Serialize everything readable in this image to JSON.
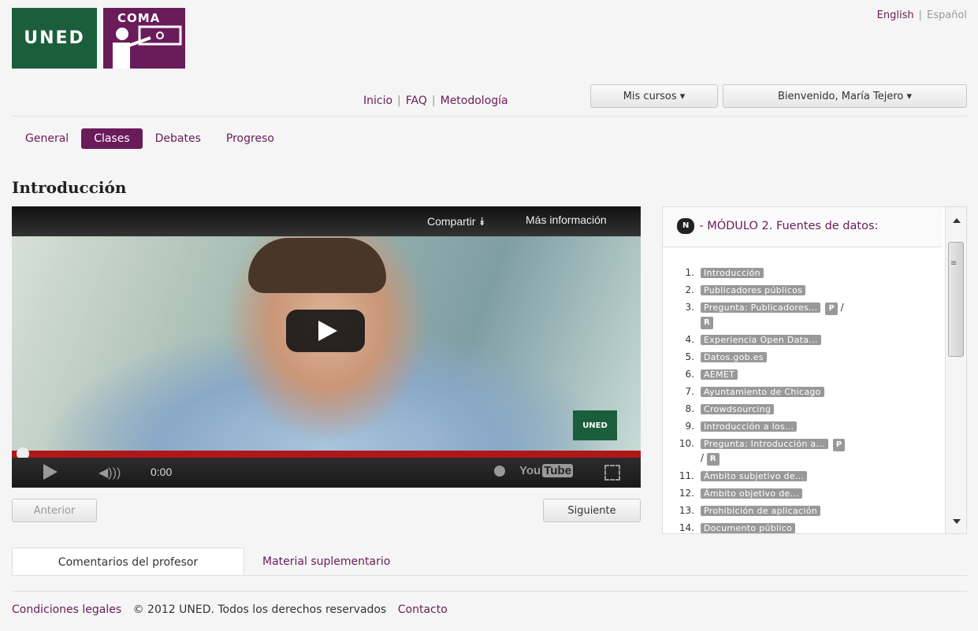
{
  "logos": {
    "uned": "UNED",
    "coma": "COMA"
  },
  "lang": {
    "english": "English",
    "sep": "|",
    "espanol": "Español"
  },
  "topnav": {
    "inicio": "Inicio",
    "faq": "FAQ",
    "metodologia": "Metodología",
    "sep": "|"
  },
  "user_menu": {
    "mis_cursos": "Mis cursos ▾",
    "bienvenido": "Bienvenido, María Tejero ▾"
  },
  "tabs": [
    "General",
    "Clases",
    "Debates",
    "Progreso"
  ],
  "page_title": "Introducción",
  "video": {
    "share": "Compartir ⯯",
    "more_info": "Más información",
    "time": "0:00",
    "youtube": "You",
    "youtube_tube": "Tube",
    "watermark": "UNED"
  },
  "nav_buttons": {
    "prev": "Anterior",
    "next": "Siguiente"
  },
  "module": {
    "badge": "N",
    "title": "- MÓDULO 2. Fuentes de datos:",
    "items": [
      {
        "num": "1.",
        "label": "Introducción"
      },
      {
        "num": "2.",
        "label": "Publicadores públicos"
      },
      {
        "num": "3.",
        "label": "Pregunta: Publicadores...",
        "p": "P",
        "slash": "/",
        "r": "R"
      },
      {
        "num": "4.",
        "label": "Experiencia Open Data..."
      },
      {
        "num": "5.",
        "label": "Datos.gob.es"
      },
      {
        "num": "6.",
        "label": "AEMET"
      },
      {
        "num": "7.",
        "label": "Ayuntamiento de Chicago"
      },
      {
        "num": "8.",
        "label": "Crowdsourcing"
      },
      {
        "num": "9.",
        "label": "Introducción a los..."
      },
      {
        "num": "10.",
        "label": "Pregunta: Introducción a...",
        "p": "P",
        "slash": "/",
        "r": "R"
      },
      {
        "num": "11.",
        "label": "Ámbito subjetivo de..."
      },
      {
        "num": "12.",
        "label": "Ámbito objetivo de..."
      },
      {
        "num": "13.",
        "label": "Prohibición de aplicación"
      },
      {
        "num": "14.",
        "label": "Documento público"
      }
    ]
  },
  "bottom_tabs": {
    "comentarios": "Comentarios del profesor",
    "material": "Material suplementario"
  },
  "footer": {
    "legal": "Condiciones legales",
    "copyright": "© 2012 UNED. Todos los derechos reservados",
    "contacto": "Contacto"
  }
}
